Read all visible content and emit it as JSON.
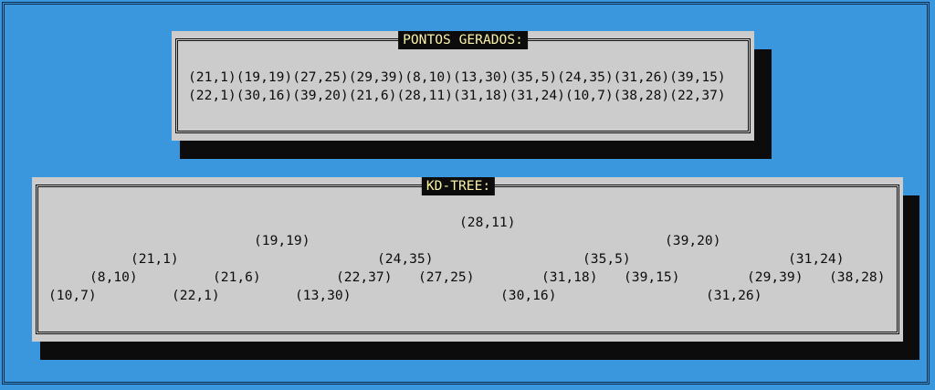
{
  "points_panel": {
    "title": "PONTOS GERADOS:",
    "lines": [
      "(21,1)(19,19)(27,25)(29,39)(8,10)(13,30)(35,5)(24,35)(31,26)(39,15)",
      "(22,1)(30,16)(39,20)(21,6)(28,11)(31,18)(31,24)(10,7)(38,28)(22,37)"
    ]
  },
  "tree_panel": {
    "title": "KD-TREE:",
    "nodes": {
      "root": "(28,11)",
      "l": "(19,19)",
      "r": "(39,20)",
      "ll": "(21,1)",
      "lr": "(24,35)",
      "rl": "(35,5)",
      "rr": "(31,24)",
      "lll": "(8,10)",
      "llr": "(21,6)",
      "lrl": "(22,37)",
      "lrr": "(27,25)",
      "rll": "(31,18)",
      "rlr": "(39,15)",
      "rrl": "(29,39)",
      "rrr": "(38,28)",
      "llll": "(10,7)",
      "llrl": "(22,1)",
      "lrll": "(13,30)",
      "rlll": "(30,16)",
      "rrll": "(31,26)"
    }
  }
}
